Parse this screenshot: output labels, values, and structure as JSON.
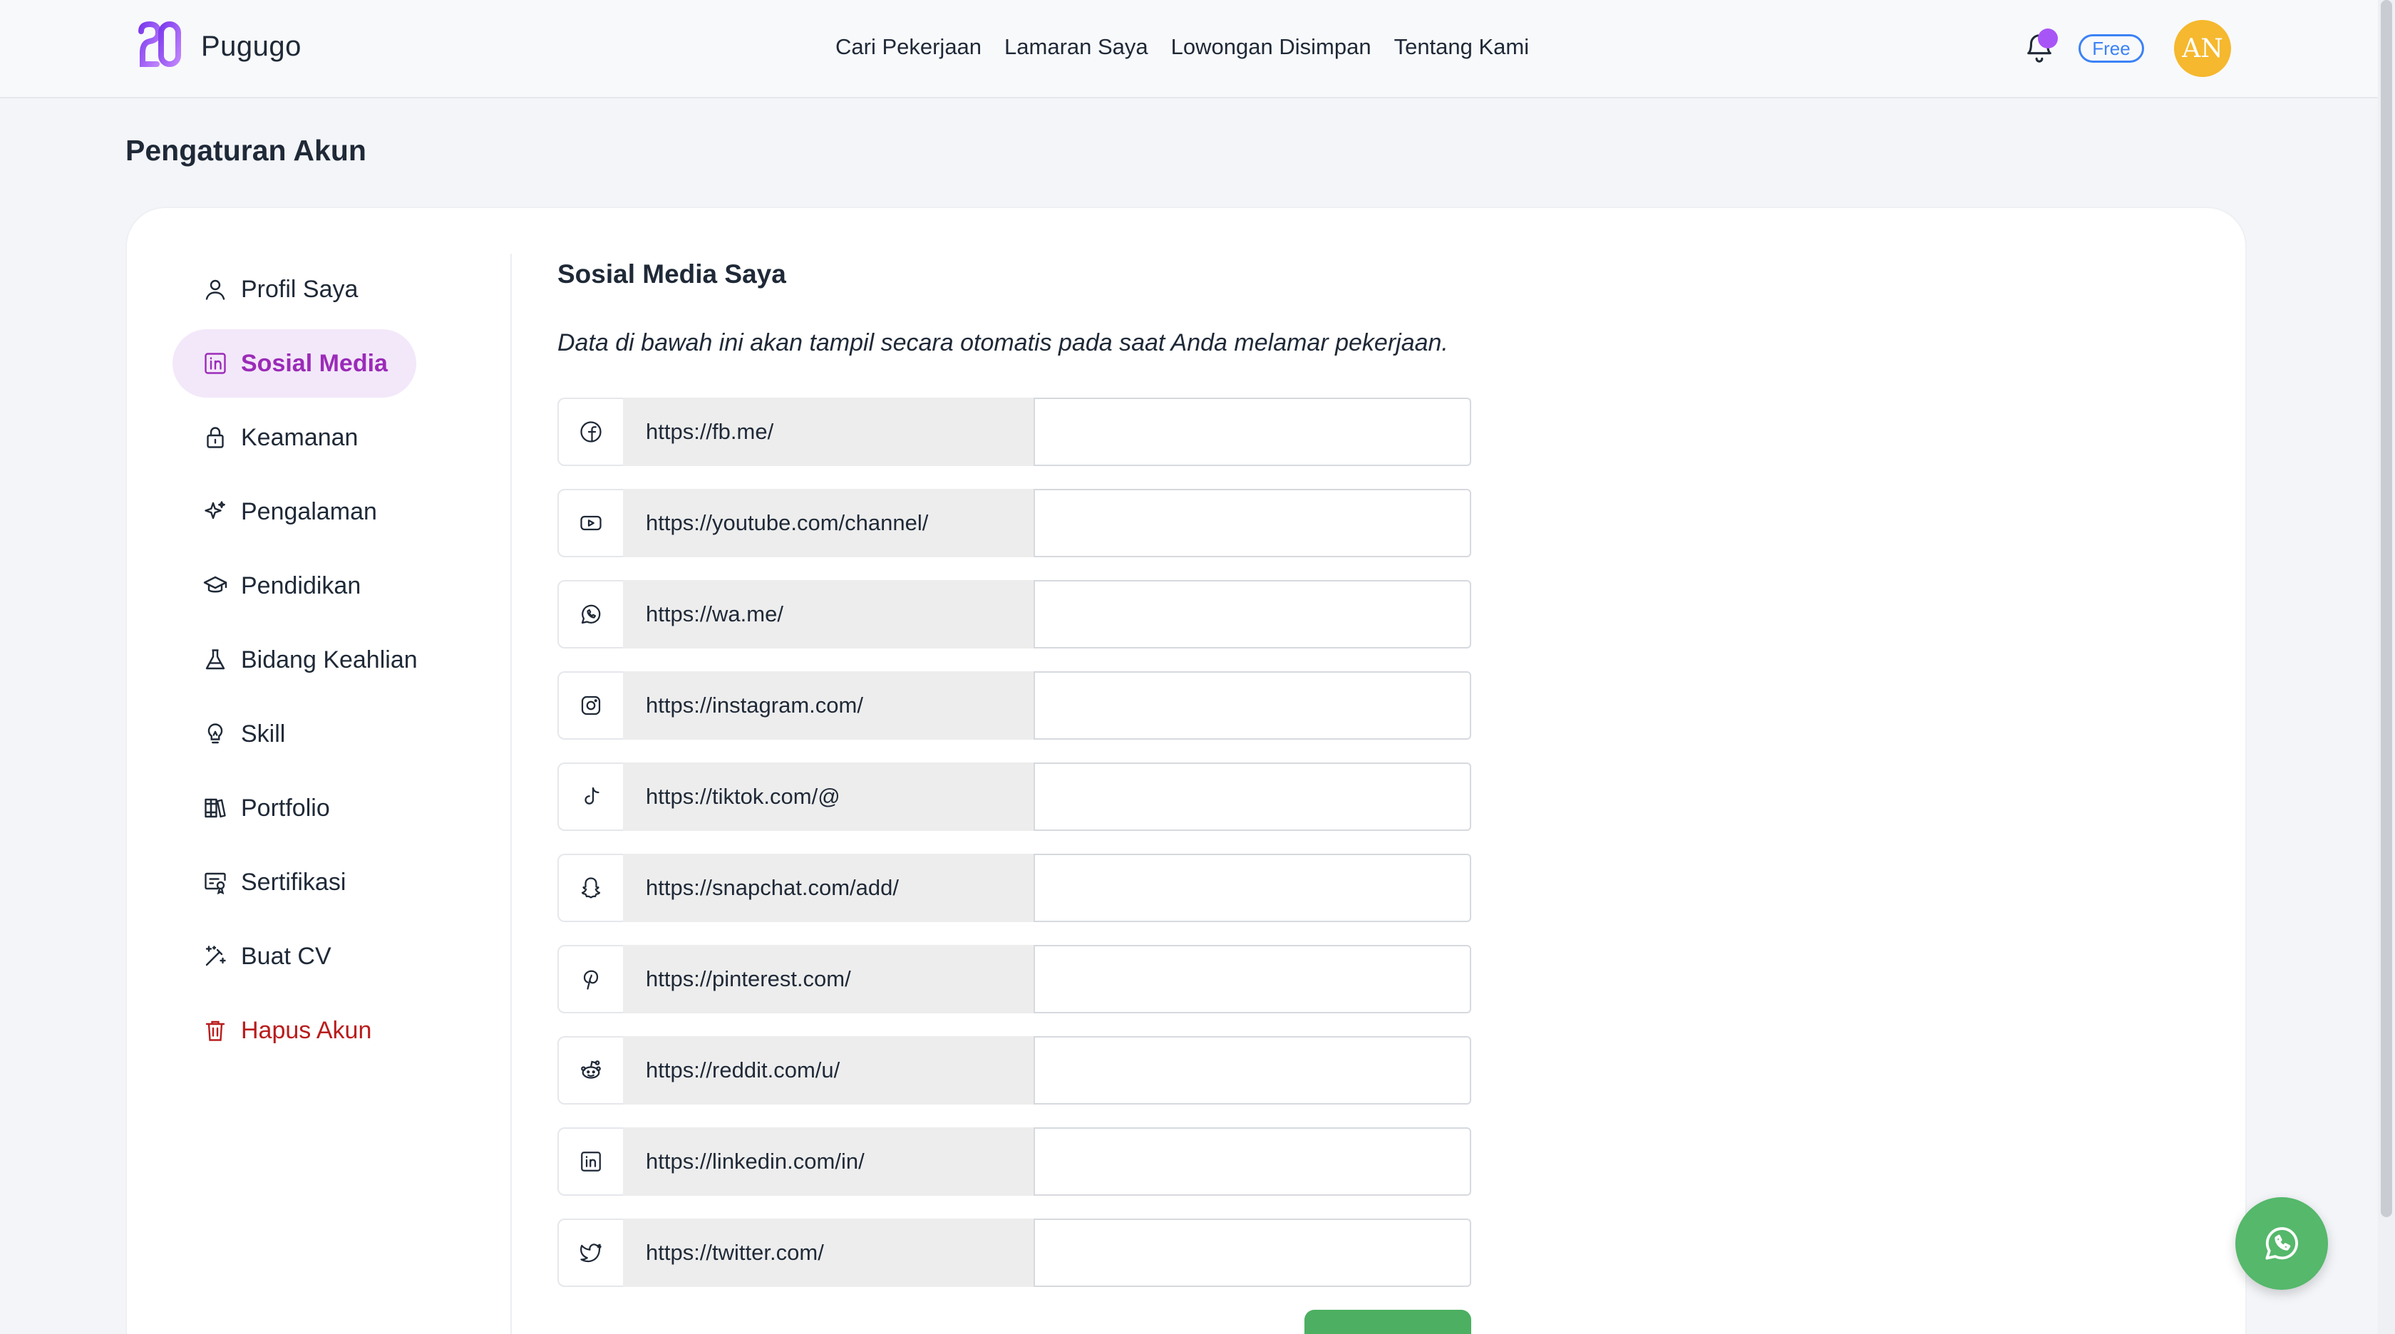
{
  "header": {
    "brand_name": "Pugugo",
    "nav": [
      {
        "label": "Cari Pekerjaan"
      },
      {
        "label": "Lamaran Saya"
      },
      {
        "label": "Lowongan Disimpan"
      },
      {
        "label": "Tentang Kami"
      }
    ],
    "plan_badge": "Free",
    "avatar_initials": "AN"
  },
  "page": {
    "title": "Pengaturan Akun"
  },
  "sidebar": {
    "items": [
      {
        "label": "Profil Saya",
        "icon": "user-icon"
      },
      {
        "label": "Sosial Media",
        "icon": "linkedin-square-icon",
        "active": true
      },
      {
        "label": "Keamanan",
        "icon": "lock-icon"
      },
      {
        "label": "Pengalaman",
        "icon": "sparkle-icon"
      },
      {
        "label": "Pendidikan",
        "icon": "graduation-cap-icon"
      },
      {
        "label": "Bidang Keahlian",
        "icon": "flask-icon"
      },
      {
        "label": "Skill",
        "icon": "lightbulb-icon"
      },
      {
        "label": "Portfolio",
        "icon": "books-icon"
      },
      {
        "label": "Sertifikasi",
        "icon": "certificate-icon"
      },
      {
        "label": "Buat CV",
        "icon": "magic-wand-icon"
      },
      {
        "label": "Hapus Akun",
        "icon": "trash-icon",
        "danger": true
      }
    ]
  },
  "main": {
    "title": "Sosial Media Saya",
    "description": "Data di bawah ini akan tampil secara otomatis pada saat Anda melamar pekerjaan.",
    "socials": [
      {
        "prefix": "https://fb.me/",
        "icon": "facebook-icon",
        "value": ""
      },
      {
        "prefix": "https://youtube.com/channel/",
        "icon": "youtube-icon",
        "value": ""
      },
      {
        "prefix": "https://wa.me/",
        "icon": "whatsapp-icon",
        "value": ""
      },
      {
        "prefix": "https://instagram.com/",
        "icon": "instagram-icon",
        "value": ""
      },
      {
        "prefix": "https://tiktok.com/@",
        "icon": "tiktok-icon",
        "value": ""
      },
      {
        "prefix": "https://snapchat.com/add/",
        "icon": "snapchat-icon",
        "value": ""
      },
      {
        "prefix": "https://pinterest.com/",
        "icon": "pinterest-icon",
        "value": ""
      },
      {
        "prefix": "https://reddit.com/u/",
        "icon": "reddit-icon",
        "value": ""
      },
      {
        "prefix": "https://linkedin.com/in/",
        "icon": "linkedin-icon",
        "value": ""
      },
      {
        "prefix": "https://twitter.com/",
        "icon": "twitter-icon",
        "value": ""
      }
    ]
  },
  "colors": {
    "accent_purple": "#9b2bb8",
    "active_bg": "#f3e8fa",
    "danger": "#b91c1c",
    "whatsapp_green": "#55b86b",
    "badge_blue": "#3b82f6",
    "avatar_yellow": "#f5b82e"
  }
}
